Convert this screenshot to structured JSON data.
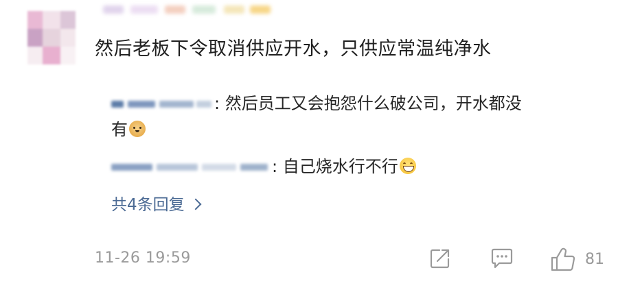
{
  "comment": {
    "text": "然后老板下令取消供应开水，只供应常温纯净水",
    "timestamp": "11-26 19:59",
    "like_count": "81"
  },
  "replies": [
    {
      "text_line1": ": 然后员工又会抱怨什么破公司，开水都没",
      "text_line2": "有",
      "emoji": "doge-emoji"
    },
    {
      "text": ": 自己烧水行不行",
      "emoji": "grin-emoji"
    }
  ],
  "more_replies_label": "共4条回复",
  "icons": {
    "share": "share-icon",
    "comment": "comment-icon",
    "like": "thumbs-up-icon",
    "more": "chevron-right-icon"
  },
  "colors": {
    "link": "#4b6a94",
    "meta": "#9a9a9a",
    "text": "#1f1f1f"
  }
}
